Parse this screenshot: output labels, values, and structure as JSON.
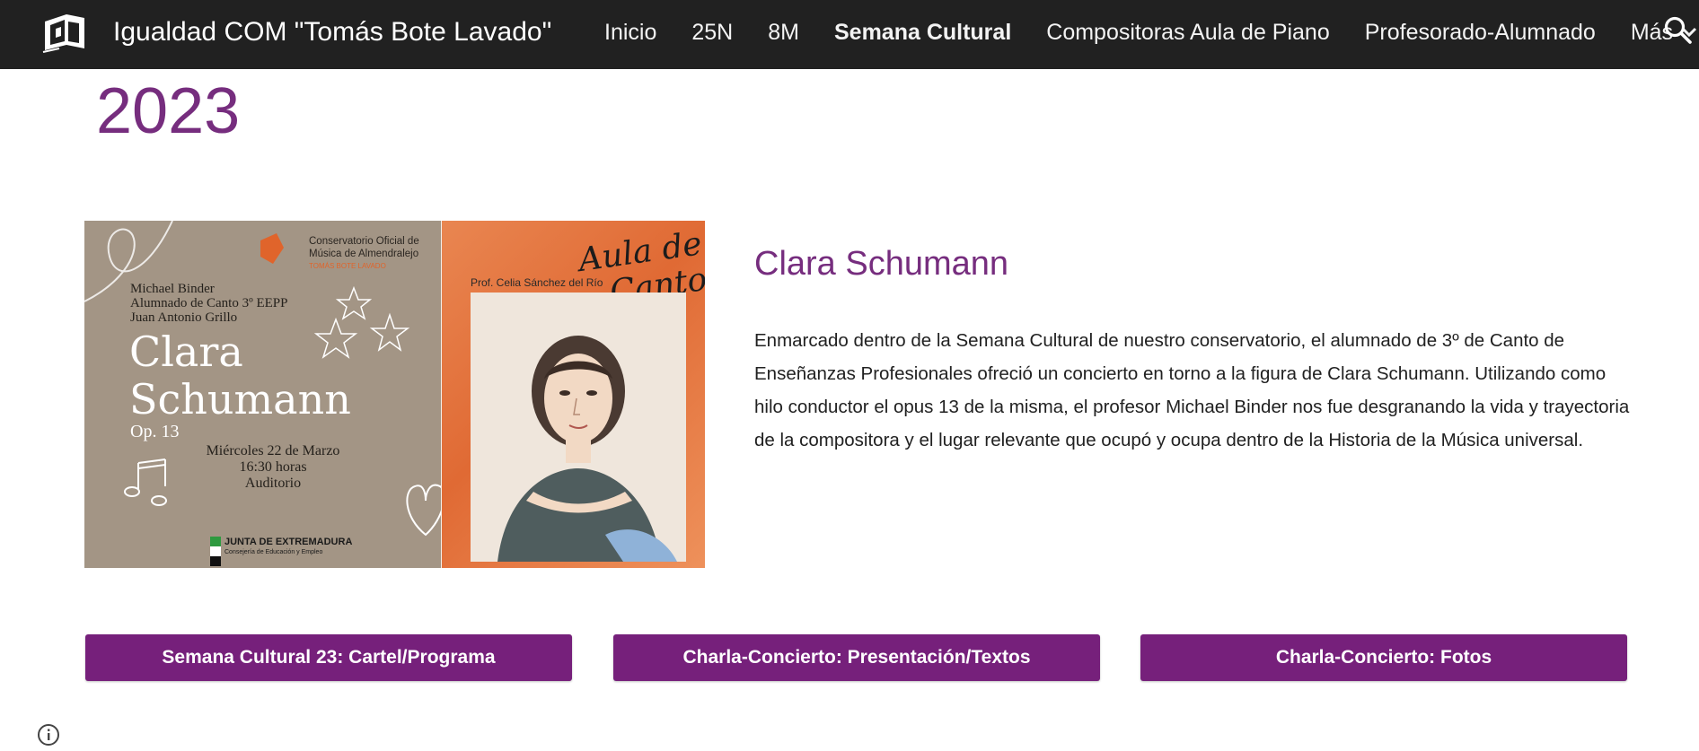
{
  "header": {
    "site_title": "Igualdad COM \"Tomás Bote Lavado\"",
    "nav": [
      {
        "label": "Inicio",
        "active": false
      },
      {
        "label": "25N",
        "active": false
      },
      {
        "label": "8M",
        "active": false
      },
      {
        "label": "Semana Cultural",
        "active": true
      },
      {
        "label": "Compositoras Aula de Piano",
        "active": false
      },
      {
        "label": "Profesorado-Alumnado",
        "active": false
      }
    ],
    "more_label": "Más",
    "icons": {
      "logo": "site-logo-icon",
      "more": "chevron-down-icon",
      "search": "search-icon"
    }
  },
  "main": {
    "year": "2023",
    "poster": {
      "conservatorio": "Conservatorio Oficial de Música de Almendralejo",
      "conservatorio_sub": "TOMÁS BOTE LAVADO",
      "names": [
        "Michael Binder",
        "Alumnado de Canto 3º EEPP",
        "Juan Antonio Grillo"
      ],
      "title_line1": "Clara",
      "title_line2": "Schumann",
      "opus": "Op. 13",
      "date": [
        "Miércoles 22 de Marzo",
        "16:30 horas",
        "Auditorio"
      ],
      "junta": "JUNTA DE EXTREMADURA",
      "junta_sub": "Consejería de Educación y Empleo",
      "aula_line1": "Aula de",
      "aula_line2": "Canto",
      "prof": "Prof. Celia Sánchez del Río"
    },
    "section_title": "Clara Schumann",
    "section_body": "Enmarcado dentro de la Semana Cultural de nuestro conservatorio, el alumnado de 3º de Canto de Enseñanzas Profesionales ofreció un concierto en torno a la figura de Clara Schumann. Utilizando como hilo conductor el opus 13 de la misma, el profesor Michael Binder nos fue desgranando la vida y trayectoria de la compositora y el lugar relevante que ocupó y ocupa dentro de la Historia de la Música universal.",
    "buttons": [
      {
        "label": "Semana Cultural 23: Cartel/Programa"
      },
      {
        "label": "Charla-Concierto: Presentación/Textos"
      },
      {
        "label": "Charla-Concierto: Fotos"
      }
    ]
  },
  "footer": {
    "info_icon": "info-icon"
  },
  "colors": {
    "topbar": "#212121",
    "accent_purple": "#762d7e",
    "button_purple": "#76207b",
    "body_text": "#212121"
  }
}
